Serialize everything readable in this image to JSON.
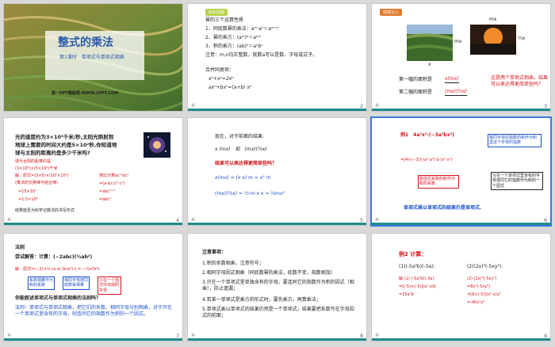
{
  "slides": [
    {
      "num": "1",
      "title": "整式的乘法",
      "subtitle": "第1课时　单项式与单项式相乘",
      "footer": "第一PPT模板网-WWW.1PPT.COM"
    },
    {
      "num": "2",
      "tag": "知识回顾",
      "heading": "幂的三个运算性质",
      "lines": [
        "1、同底数幂的乘法：aᵐ·aⁿ＝aᵐ⁺ⁿ",
        "2、幂的乘方：(aᵐ)ⁿ＝aᵐⁿ",
        "3、积的乘方：(ab)ⁿ＝aⁿbⁿ",
        "注意：m,n均正整数，底数a可以是数、字母或式子。",
        "合并同类项：",
        "xⁿ+xⁿ=2xⁿ",
        "axⁿ+bxⁿ=(a+b) xⁿ"
      ]
    },
    {
      "num": "3",
      "tag": "情境引入",
      "q1": "第一幅的面积是",
      "a1": "x(mx)",
      "q2": "第二幅的面积是",
      "a2": "(mx)(⅔x)",
      "label_x": "x",
      "label_mx": "mx",
      "label_23x": "⅔x",
      "question": "这是两个单项式相乘，结果可以表达得更简单些吗？"
    },
    {
      "num": "4",
      "lines": [
        "光的速度约为3×10⁵千米/秒,太阳光照射到",
        "地球上需要的时间大约是5×10²秒,你知道地",
        "球与太阳的距离约是多少千米吗?"
      ],
      "red_lines": [
        "球与太阳的距离约是",
        "(3×10⁵)×(5×10²)千米",
        "解：原式=(3×5)×(10⁵×10²)",
        "(乘法的交换律与结合律)",
        "=15×10⁷",
        "=1.5×10⁸"
      ],
      "right_lines": [
        "类比计算ac⁵·bc²",
        "=(a·b)·(c⁵·c²)",
        "=abc⁵⁺²",
        "=abc⁷"
      ],
      "note": "结果能否为科学记数法的书写形式"
    },
    {
      "num": "5",
      "lines": [
        "现在，对于前面的结果:",
        "x (mx)　和　(mx)(⅔x)"
      ],
      "question": "结果可以表达得更简单些吗？",
      "eq1": "x(mx) = (x·x)·m = x² m",
      "eq2": "(mx)(⅔x) = ⅔·m·x·x = ⅔mx²"
    },
    {
      "num": "6",
      "example": "例1　4a²x²·(−3a³bx²)",
      "note_top": "相同字母的指数的和作为积里这个字母的指数",
      "note_left": "各因式系数的积作为积的系数",
      "note_right": "只在一个单项式里含有的字母连同它的指数作为积的一个因式",
      "conclusion": "单项式乘以单项式的结果仍是单项式."
    },
    {
      "num": "7",
      "rule_title": "法则",
      "try": "尝试解答：计算：(−2abc)(⅓ab²)",
      "solution": "解：原式=(−2)×⅓·(a·a)·(b·b²)·c = −⅔a²b³c",
      "box1": "系数相乘作为积的系数",
      "box2": "相同字母按同底数幂相乘",
      "box3": "只在一个因式中出现的字母",
      "question": "你能叙述单项式与单项式相乘的法则吗？",
      "rule": "法则：单项式与单项式相乘，把它们的系数、相同字母分别相乘，对于只在一个单项式里含有的字母，则连同它的指数作为积的一个因式。"
    },
    {
      "num": "8",
      "heading": "注意事项：",
      "items": [
        "1.积的系数相乘，注意符号；",
        "2.相同字母因式相乘（同底数幂的乘法，底数不变，指数相加）",
        "3.只在一个单项式里单独含有的字母，要连同它的指数作为积的因式（相乘），防止遗漏；",
        "4.若某一单项式是乘方的形式时，要先乘方，再算乘法；",
        "5.单项式乘以单项式的结果仍然是一个单项式，结果要把系数写在字母因式的前面；"
      ]
    },
    {
      "num": "9",
      "title": "例2 计算：",
      "p1": "(1)(-5a²b)(-3a);",
      "p2": "(2)(2x)³(-5xy²).",
      "s1": [
        "解:(1) (-5a²b)(-3a)",
        "=[(-5)×(-3)](a²·a)b",
        "=15a³b"
      ],
      "s2": [
        "(2) (2x)³(-5xy²)",
        "=8x³(-5xy²)",
        "=[8×(-5)](x³·x)y²",
        "=-40x⁴y²"
      ]
    }
  ]
}
